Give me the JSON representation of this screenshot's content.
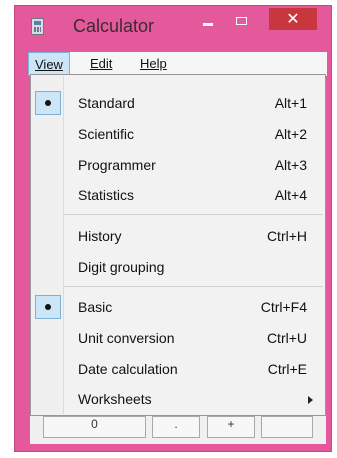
{
  "window": {
    "title": "Calculator",
    "close_symbol": "✕",
    "accent_color": "#e4599c"
  },
  "menubar": {
    "items": [
      {
        "label": "View",
        "active": true
      },
      {
        "label": "Edit"
      },
      {
        "label": "Help"
      }
    ]
  },
  "dropdown": {
    "items": [
      {
        "label": "Standard",
        "shortcut": "Alt+1",
        "checked": true
      },
      {
        "label": "Scientific",
        "shortcut": "Alt+2"
      },
      {
        "label": "Programmer",
        "shortcut": "Alt+3"
      },
      {
        "label": "Statistics",
        "shortcut": "Alt+4"
      },
      {
        "label": "History",
        "shortcut": "Ctrl+H"
      },
      {
        "label": "Digit grouping",
        "shortcut": ""
      },
      {
        "label": "Basic",
        "shortcut": "Ctrl+F4",
        "checked": true
      },
      {
        "label": "Unit conversion",
        "shortcut": "Ctrl+U"
      },
      {
        "label": "Date calculation",
        "shortcut": "Ctrl+E"
      },
      {
        "label": "Worksheets",
        "shortcut": "",
        "submenu": true
      }
    ]
  },
  "keypad": {
    "zero": "0",
    "dot": ".",
    "plus": "+"
  }
}
